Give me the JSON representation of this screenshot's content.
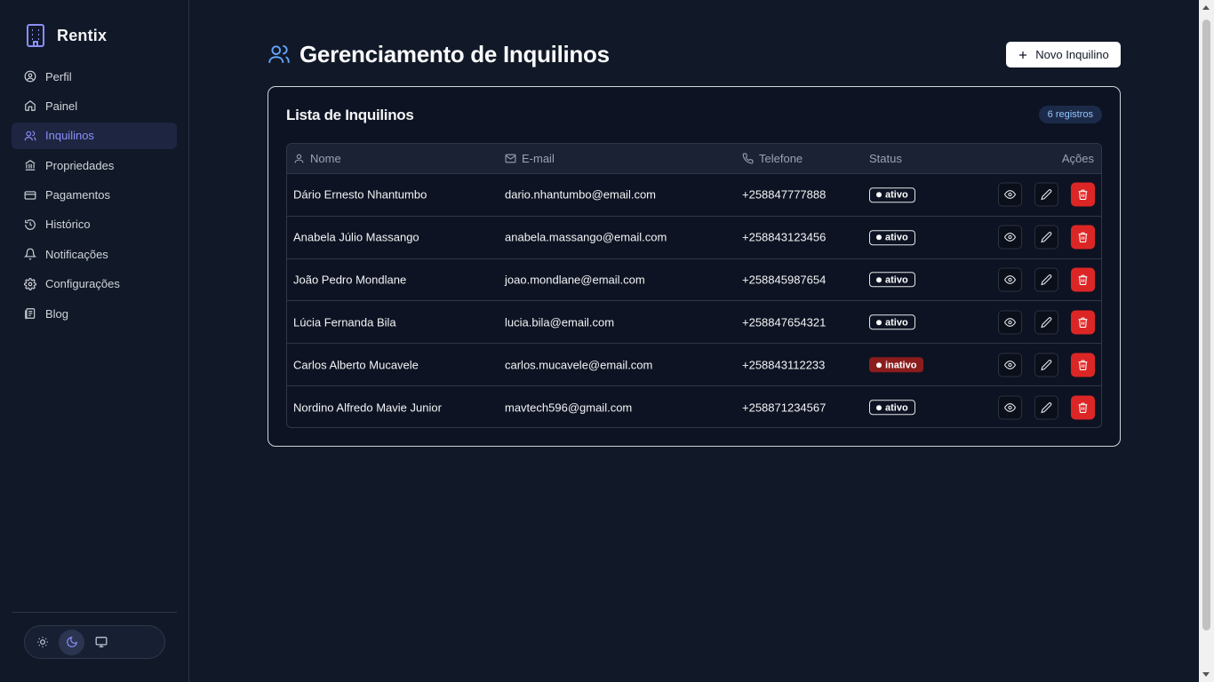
{
  "app": {
    "name": "Rentix"
  },
  "sidebar": {
    "items": [
      {
        "label": "Perfil",
        "icon": "user-circle-icon",
        "active": false
      },
      {
        "label": "Painel",
        "icon": "home-icon",
        "active": false
      },
      {
        "label": "Inquilinos",
        "icon": "users-icon",
        "active": true
      },
      {
        "label": "Propriedades",
        "icon": "bank-icon",
        "active": false
      },
      {
        "label": "Pagamentos",
        "icon": "credit-card-icon",
        "active": false
      },
      {
        "label": "Histórico",
        "icon": "history-icon",
        "active": false
      },
      {
        "label": "Notificações",
        "icon": "bell-icon",
        "active": false
      },
      {
        "label": "Configurações",
        "icon": "gear-icon",
        "active": false
      },
      {
        "label": "Blog",
        "icon": "book-icon",
        "active": false
      }
    ],
    "theme": {
      "options": [
        "sun-icon",
        "moon-icon",
        "monitor-icon"
      ],
      "selected": "moon-icon"
    }
  },
  "header": {
    "title": "Gerenciamento de Inquilinos",
    "new_button": "Novo Inquilino"
  },
  "card": {
    "title": "Lista de Inquilinos",
    "count_badge": "6 registros"
  },
  "table": {
    "columns": {
      "name": "Nome",
      "email": "E-mail",
      "phone": "Telefone",
      "status": "Status",
      "actions": "Ações"
    },
    "rows": [
      {
        "name": "Dário Ernesto Nhantumbo",
        "email": "dario.nhantumbo@email.com",
        "phone": "+258847777888",
        "status": "ativo"
      },
      {
        "name": "Anabela Júlio Massango",
        "email": "anabela.massango@email.com",
        "phone": "+258843123456",
        "status": "ativo"
      },
      {
        "name": "João Pedro Mondlane",
        "email": "joao.mondlane@email.com",
        "phone": "+258845987654",
        "status": "ativo"
      },
      {
        "name": "Lúcia Fernanda Bila",
        "email": "lucia.bila@email.com",
        "phone": "+258847654321",
        "status": "ativo"
      },
      {
        "name": "Carlos Alberto Mucavele",
        "email": "carlos.mucavele@email.com",
        "phone": "+258843112233",
        "status": "inativo"
      },
      {
        "name": "Nordino Alfredo Mavie Junior",
        "email": "mavtech596@gmail.com",
        "phone": "+258871234567",
        "status": "ativo"
      }
    ]
  },
  "colors": {
    "background": "#111827",
    "accent": "#8b8ff8",
    "danger": "#dc2626",
    "inactive": "#8b1d1d"
  }
}
